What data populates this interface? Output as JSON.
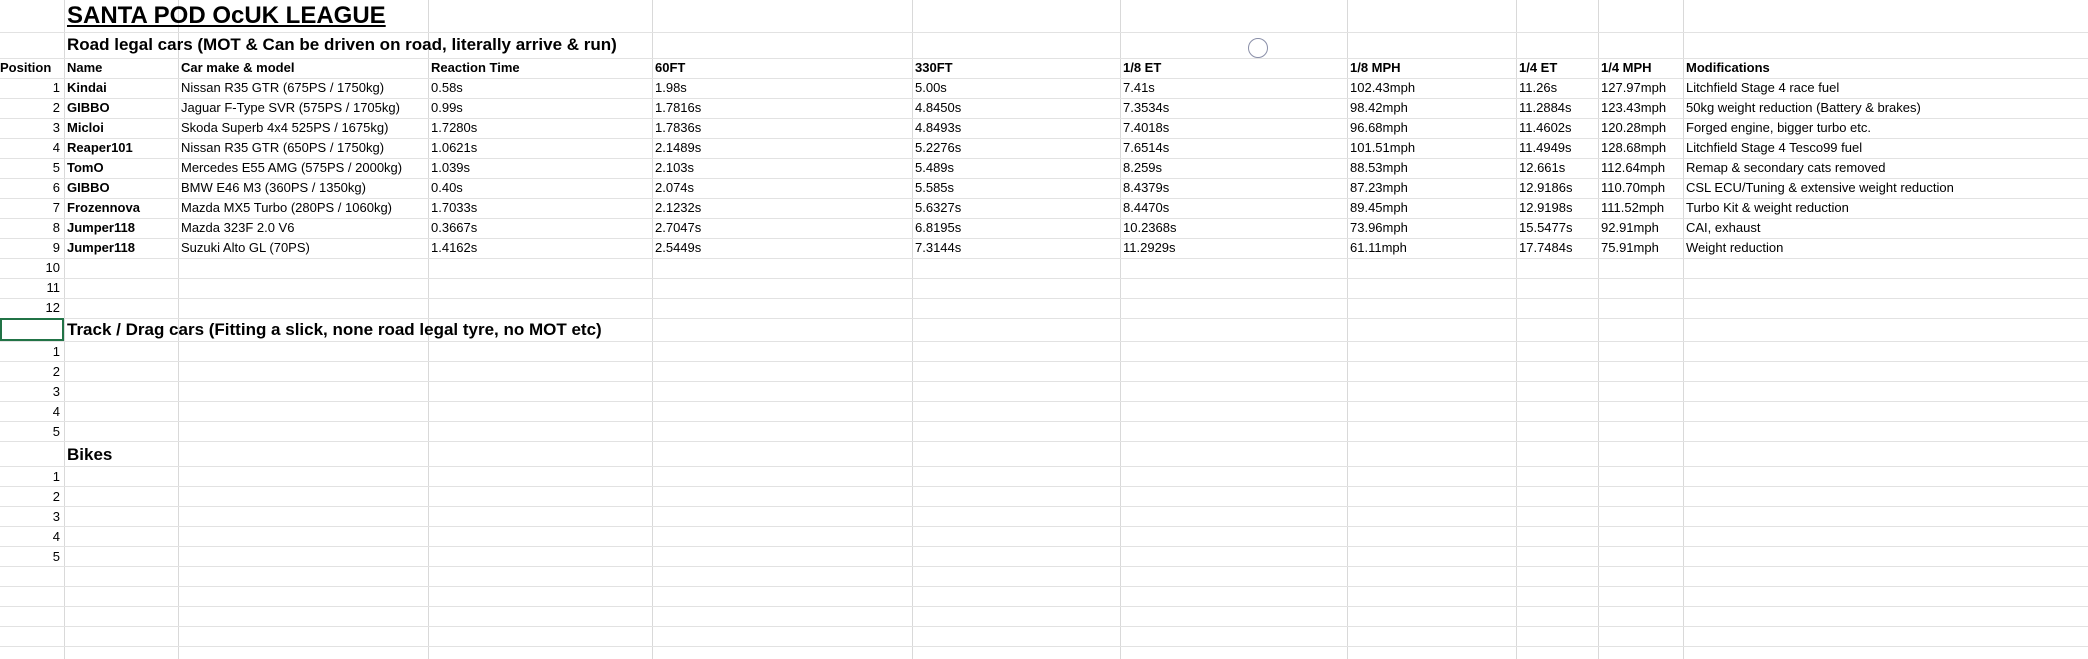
{
  "title": "SANTA POD OcUK LEAGUE",
  "road_section": {
    "heading": "Road legal cars (MOT & Can be driven on road, literally arrive & run)",
    "headers": [
      "Position",
      "Name",
      "Car make & model",
      "Reaction Time",
      "60FT",
      "330FT",
      "1/8 ET",
      "1/8 MPH",
      "1/4 ET",
      "1/4 MPH",
      "Modifications"
    ],
    "rows": [
      [
        "1",
        "Kindai",
        "Nissan R35 GTR (675PS / 1750kg)",
        "0.58s",
        "1.98s",
        "5.00s",
        "7.41s",
        "102.43mph",
        "11.26s",
        "127.97mph",
        "Litchfield Stage 4 race fuel"
      ],
      [
        "2",
        "GIBBO",
        "Jaguar F-Type SVR (575PS / 1705kg)",
        "0.99s",
        "1.7816s",
        "4.8450s",
        "7.3534s",
        "98.42mph",
        "11.2884s",
        "123.43mph",
        "50kg weight reduction (Battery & brakes)"
      ],
      [
        "3",
        "Micloi",
        "Skoda Superb 4x4 525PS / 1675kg)",
        "1.7280s",
        "1.7836s",
        "4.8493s",
        "7.4018s",
        "96.68mph",
        "11.4602s",
        "120.28mph",
        "Forged engine, bigger turbo etc."
      ],
      [
        "4",
        "Reaper101",
        "Nissan R35 GTR (650PS / 1750kg)",
        "1.0621s",
        "2.1489s",
        "5.2276s",
        "7.6514s",
        "101.51mph",
        "11.4949s",
        "128.68mph",
        "Litchfield Stage 4 Tesco99 fuel"
      ],
      [
        "5",
        "TomO",
        "Mercedes E55 AMG (575PS / 2000kg)",
        "1.039s",
        "2.103s",
        "5.489s",
        "8.259s",
        "88.53mph",
        "12.661s",
        "112.64mph",
        "Remap & secondary cats removed"
      ],
      [
        "6",
        "GIBBO",
        "BMW E46 M3 (360PS / 1350kg)",
        "0.40s",
        "2.074s",
        "5.585s",
        "8.4379s",
        "87.23mph",
        "12.9186s",
        "110.70mph",
        "CSL ECU/Tuning & extensive weight reduction"
      ],
      [
        "7",
        "Frozennova",
        "Mazda MX5 Turbo (280PS / 1060kg)",
        "1.7033s",
        "2.1232s",
        "5.6327s",
        "8.4470s",
        "89.45mph",
        "12.9198s",
        "111.52mph",
        "Turbo Kit & weight reduction"
      ],
      [
        "8",
        "Jumper118",
        "Mazda 323F 2.0 V6",
        "0.3667s",
        "2.7047s",
        "6.8195s",
        "10.2368s",
        "73.96mph",
        "15.5477s",
        "92.91mph",
        "CAI, exhaust"
      ],
      [
        "9",
        "Jumper118",
        "Suzuki Alto GL (70PS)",
        "1.4162s",
        "2.5449s",
        "7.3144s",
        "11.2929s",
        "61.11mph",
        "17.7484s",
        "75.91mph",
        "Weight reduction"
      ],
      [
        "10",
        "",
        "",
        "",
        "",
        "",
        "",
        "",
        "",
        "",
        ""
      ],
      [
        "11",
        "",
        "",
        "",
        "",
        "",
        "",
        "",
        "",
        "",
        ""
      ],
      [
        "12",
        "",
        "",
        "",
        "",
        "",
        "",
        "",
        "",
        "",
        ""
      ]
    ]
  },
  "track_section": {
    "heading": "Track / Drag cars (Fitting a slick, none road legal tyre, no MOT etc)",
    "positions": [
      "1",
      "2",
      "3",
      "4",
      "5"
    ]
  },
  "bikes_section": {
    "heading": "Bikes",
    "positions": [
      "1",
      "2",
      "3",
      "4",
      "5"
    ]
  }
}
